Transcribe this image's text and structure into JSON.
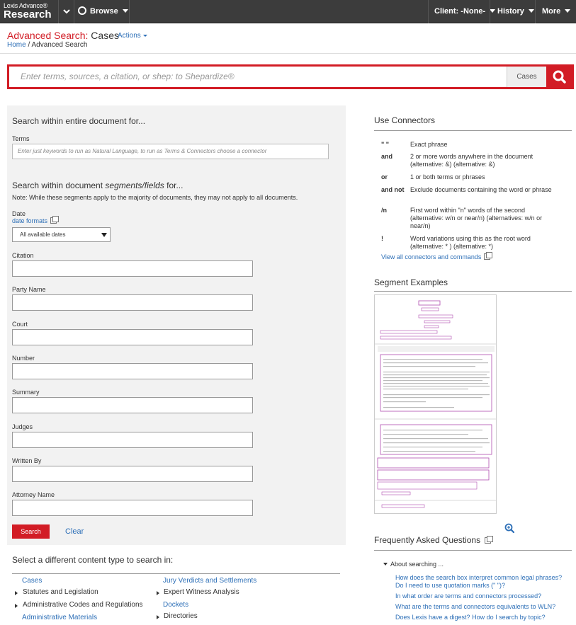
{
  "topbar": {
    "logo_line1": "Lexis Advance®",
    "logo_line2": "Research",
    "browse": "Browse",
    "client": "Client: -None-",
    "history": "History",
    "more": "More"
  },
  "header": {
    "title_red": "Advanced Search:",
    "title_dark": " Cases",
    "actions": "Actions",
    "crumb_home": "Home",
    "crumb_sep": " / ",
    "crumb_current": "Advanced Search"
  },
  "search": {
    "placeholder": "Enter terms, sources, a citation, or shep: to Shepardize®",
    "content_type": "Cases"
  },
  "form": {
    "entire_heading": "Search within entire document for...",
    "terms_label": "Terms",
    "terms_placeholder": "Enter just keywords to run as Natural Language, to run as Terms & Connectors choose a connector",
    "segments_heading_prefix": "Search within document ",
    "segments_heading_em": "segments/fields",
    "segments_heading_suffix": " for...",
    "note": "Note: While these segments apply to the majority of documents, they may not apply to all documents.",
    "date_label": "Date",
    "date_formats": "date formats",
    "date_select": "All available dates",
    "fields": [
      "Citation",
      "Party Name",
      "Court",
      "Number",
      "Summary",
      "Judges",
      "Written By",
      "Attorney Name"
    ],
    "search_button": "Search",
    "clear_button": "Clear"
  },
  "content_types": {
    "heading": "Select a different content type to search in:",
    "left": [
      {
        "label": "Cases",
        "kind": "link"
      },
      {
        "label": "Statutes and Legislation",
        "kind": "expand"
      },
      {
        "label": "Administrative Codes and Regulations",
        "kind": "expand"
      },
      {
        "label": "Administrative Materials",
        "kind": "link"
      }
    ],
    "right": [
      {
        "label": "Jury Verdicts and Settlements",
        "kind": "link"
      },
      {
        "label": "Expert Witness Analysis",
        "kind": "expand"
      },
      {
        "label": "Dockets",
        "kind": "link"
      },
      {
        "label": "Directories",
        "kind": "expand"
      }
    ]
  },
  "connectors": {
    "heading": "Use Connectors",
    "rows": [
      {
        "sym": "\" \"",
        "desc": "Exact phrase"
      },
      {
        "sym": "and",
        "desc": "2 or more words anywhere in the document (alternative: &) (alternative: &)"
      },
      {
        "sym": "or",
        "desc": "1 or both terms or phrases"
      },
      {
        "sym": "and not",
        "desc": "Exclude documents containing the word or phrase"
      },
      {
        "sym": "/n",
        "desc": "First word within \"n\" words of the second (alternative: w/n or near/n) (alternatives: w/n or near/n)"
      },
      {
        "sym": "!",
        "desc": "Word variations using this as the root word (alternative: * ) (alternative: *)"
      }
    ],
    "view_all": "View all connectors and commands"
  },
  "segments": {
    "heading": "Segment Examples"
  },
  "faq": {
    "heading": "Frequently Asked Questions",
    "group": "About searching ...",
    "items": [
      "How does the search box interpret common legal phrases?",
      "Do I need to use quotation marks (\" \")?",
      "In what order are terms and connectors processed?",
      "What are the terms and connectors equivalents to WLN?",
      "Does Lexis have a digest? How do I search by topic?"
    ]
  },
  "colors": {
    "brand_red": "#d21c25",
    "link_blue": "#2d6fb7",
    "topbar_bg": "#3c3c3c",
    "panel_bg": "#f2f2f2"
  }
}
